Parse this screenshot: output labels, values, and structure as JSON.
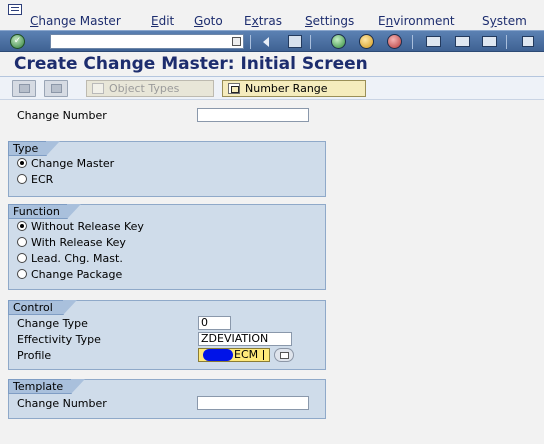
{
  "menubar": {
    "items": [
      "Change Master",
      "Edit",
      "Goto",
      "Extras",
      "Settings",
      "Environment",
      "System"
    ],
    "access_keys": [
      "C",
      "E",
      "G",
      "x",
      "S",
      "n",
      "y"
    ]
  },
  "toolbar": {
    "command_field_value": ""
  },
  "title": "Create Change Master: Initial Screen",
  "app_toolbar": {
    "object_types_label": "Object Types",
    "number_range_label": "Number Range"
  },
  "change_number_label": "Change Number",
  "change_number_value": "",
  "type_group": {
    "title": "Type",
    "options": [
      "Change Master",
      "ECR"
    ],
    "selected": "Change Master"
  },
  "function_group": {
    "title": "Function",
    "options": [
      "Without Release Key",
      "With Release Key",
      "Lead. Chg. Mast.",
      "Change Package"
    ],
    "selected": "Without Release Key"
  },
  "control_group": {
    "title": "Control",
    "change_type_label": "Change Type",
    "change_type_value": "0",
    "effectivity_type_label": "Effectivity Type",
    "effectivity_type_value": "ZDEVIATION",
    "profile_label": "Profile",
    "profile_value_visible": "ECM"
  },
  "template_group": {
    "title": "Template",
    "change_number_label": "Change Number",
    "change_number_value": ""
  },
  "colors": {
    "toolbar_blue": "#4a6fa0",
    "title_text": "#1d2d6e",
    "group_bg": "#cfdcea",
    "group_tab": "#a9c0dc",
    "button_yellow": "#f5ecbd",
    "focus_field": "#ffe97a"
  }
}
